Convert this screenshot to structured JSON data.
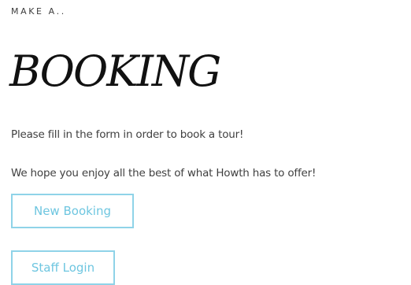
{
  "header": {
    "eyebrow": "MAKE A..",
    "title": "BOOKING"
  },
  "content": {
    "intro": "Please fill in the form in order to book a tour!",
    "tagline": "We hope you enjoy all the best of what Howth has to offer!"
  },
  "actions": {
    "new_booking_label": "New Booking",
    "staff_login_label": "Staff Login"
  },
  "colors": {
    "accent": "#8fd3e8",
    "button_text": "#6ec6e0",
    "title_text": "#111111",
    "body_text": "#3f3f3f"
  }
}
